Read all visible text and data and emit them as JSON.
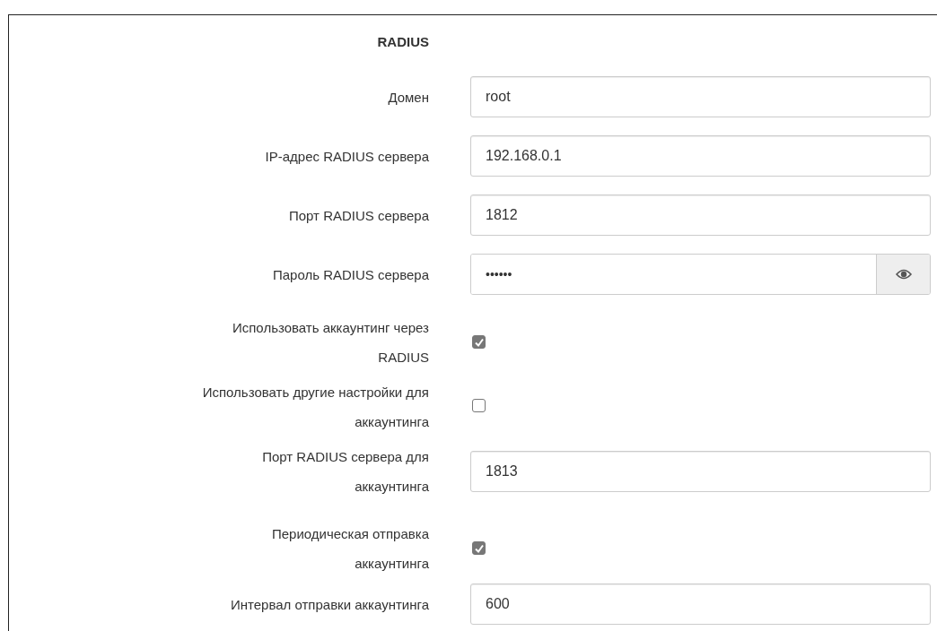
{
  "section": {
    "title": "RADIUS"
  },
  "fields": [
    {
      "kind": "text",
      "label": "Домен",
      "value": "root"
    },
    {
      "kind": "text",
      "label": "IP-адрес RADIUS сервера",
      "value": "192.168.0.1"
    },
    {
      "kind": "text",
      "label": "Порт RADIUS сервера",
      "value": "1812"
    },
    {
      "kind": "password",
      "label": "Пароль RADIUS сервера",
      "value": "••••••"
    },
    {
      "kind": "checkbox",
      "label": "Использовать аккаунтинг через\nRADIUS",
      "checked": true
    },
    {
      "kind": "checkbox",
      "label": "Использовать другие настройки для\nаккаунтинга",
      "checked": false
    },
    {
      "kind": "text",
      "label": "Порт RADIUS сервера для\nаккаунтинга",
      "value": "1813"
    },
    {
      "kind": "checkbox",
      "label": "Периодическая отправка\nаккаунтинга",
      "checked": true
    },
    {
      "kind": "text",
      "label": "Интервал отправки аккаунтинга",
      "value": "600"
    }
  ]
}
